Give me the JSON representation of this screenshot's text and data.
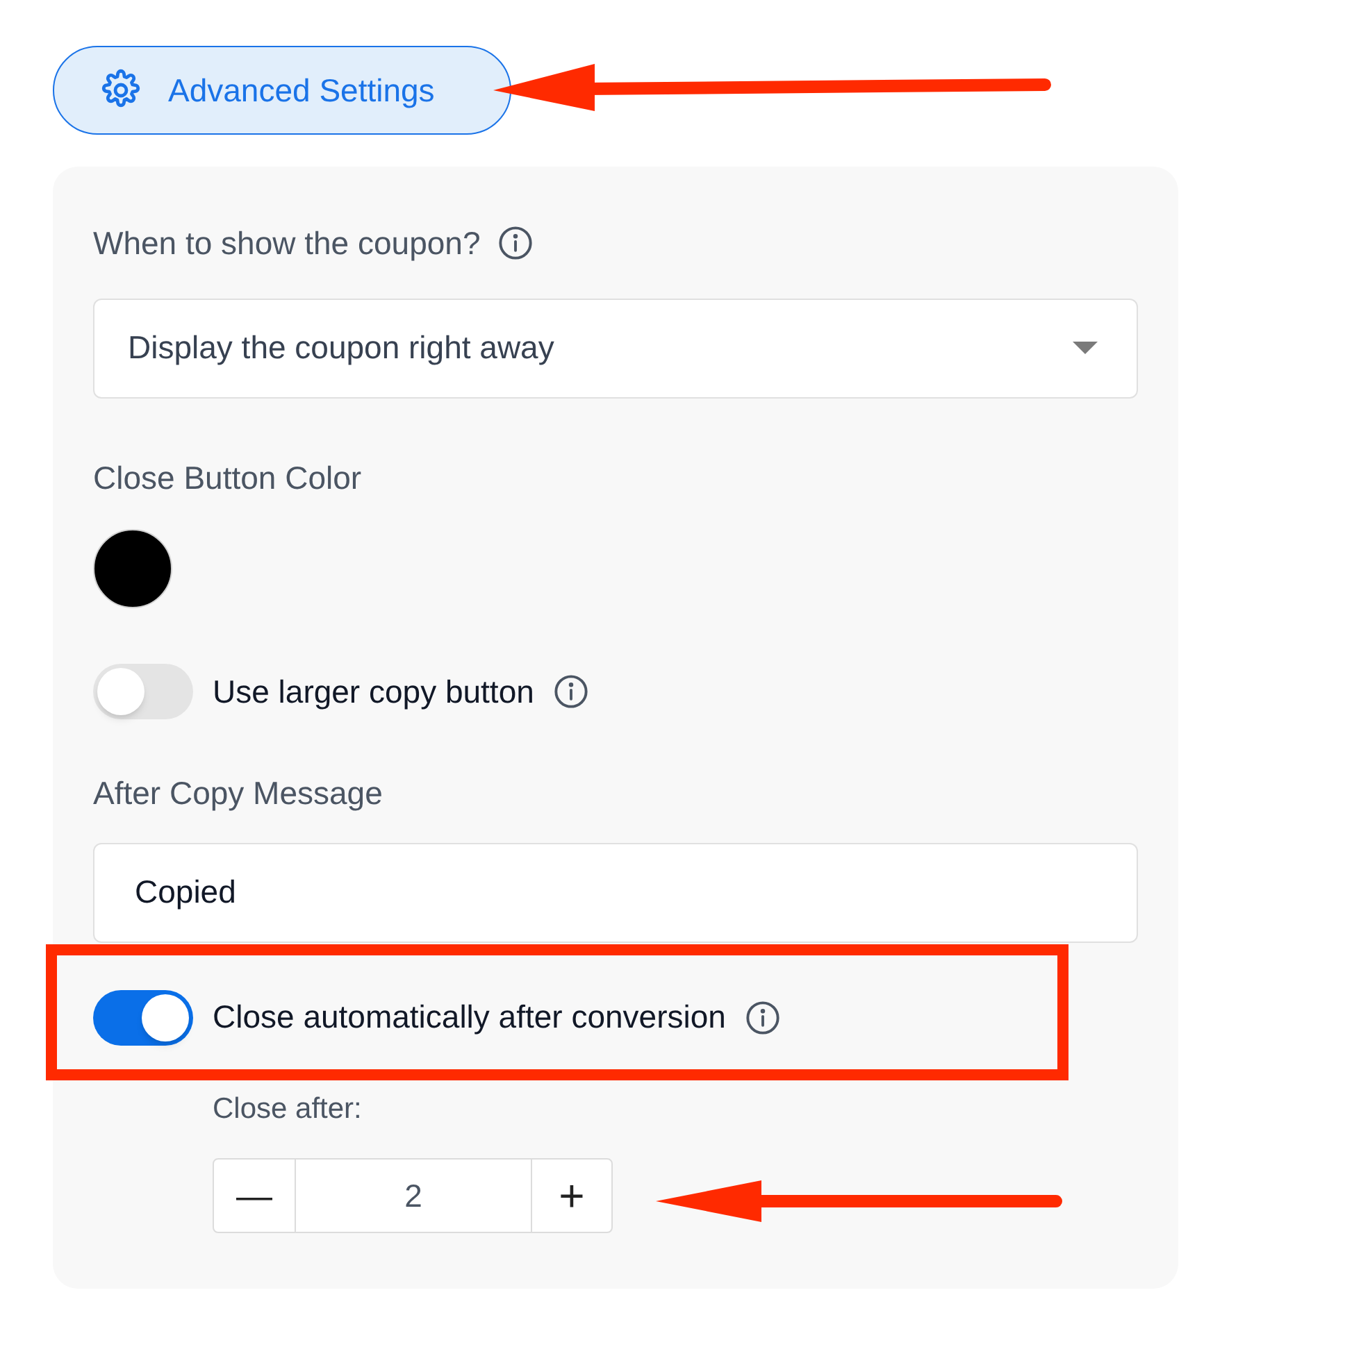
{
  "advanced_settings_button": {
    "label": "Advanced Settings"
  },
  "fields": [
    {
      "kind": "select",
      "label": "When to show the coupon?",
      "info": true,
      "value": "Display the coupon right away"
    },
    {
      "kind": "color",
      "label": "Close Button Color",
      "color": "#000000"
    },
    {
      "kind": "toggle",
      "label": "Use larger copy button",
      "info": true,
      "on": false
    },
    {
      "kind": "text",
      "label": "After Copy Message",
      "value": "Copied"
    },
    {
      "kind": "toggle",
      "label": "Close automatically after conversion",
      "info": true,
      "on": true,
      "sub": {
        "label": "Close after:",
        "value": "2",
        "decrement": "—",
        "increment": "+"
      }
    }
  ]
}
